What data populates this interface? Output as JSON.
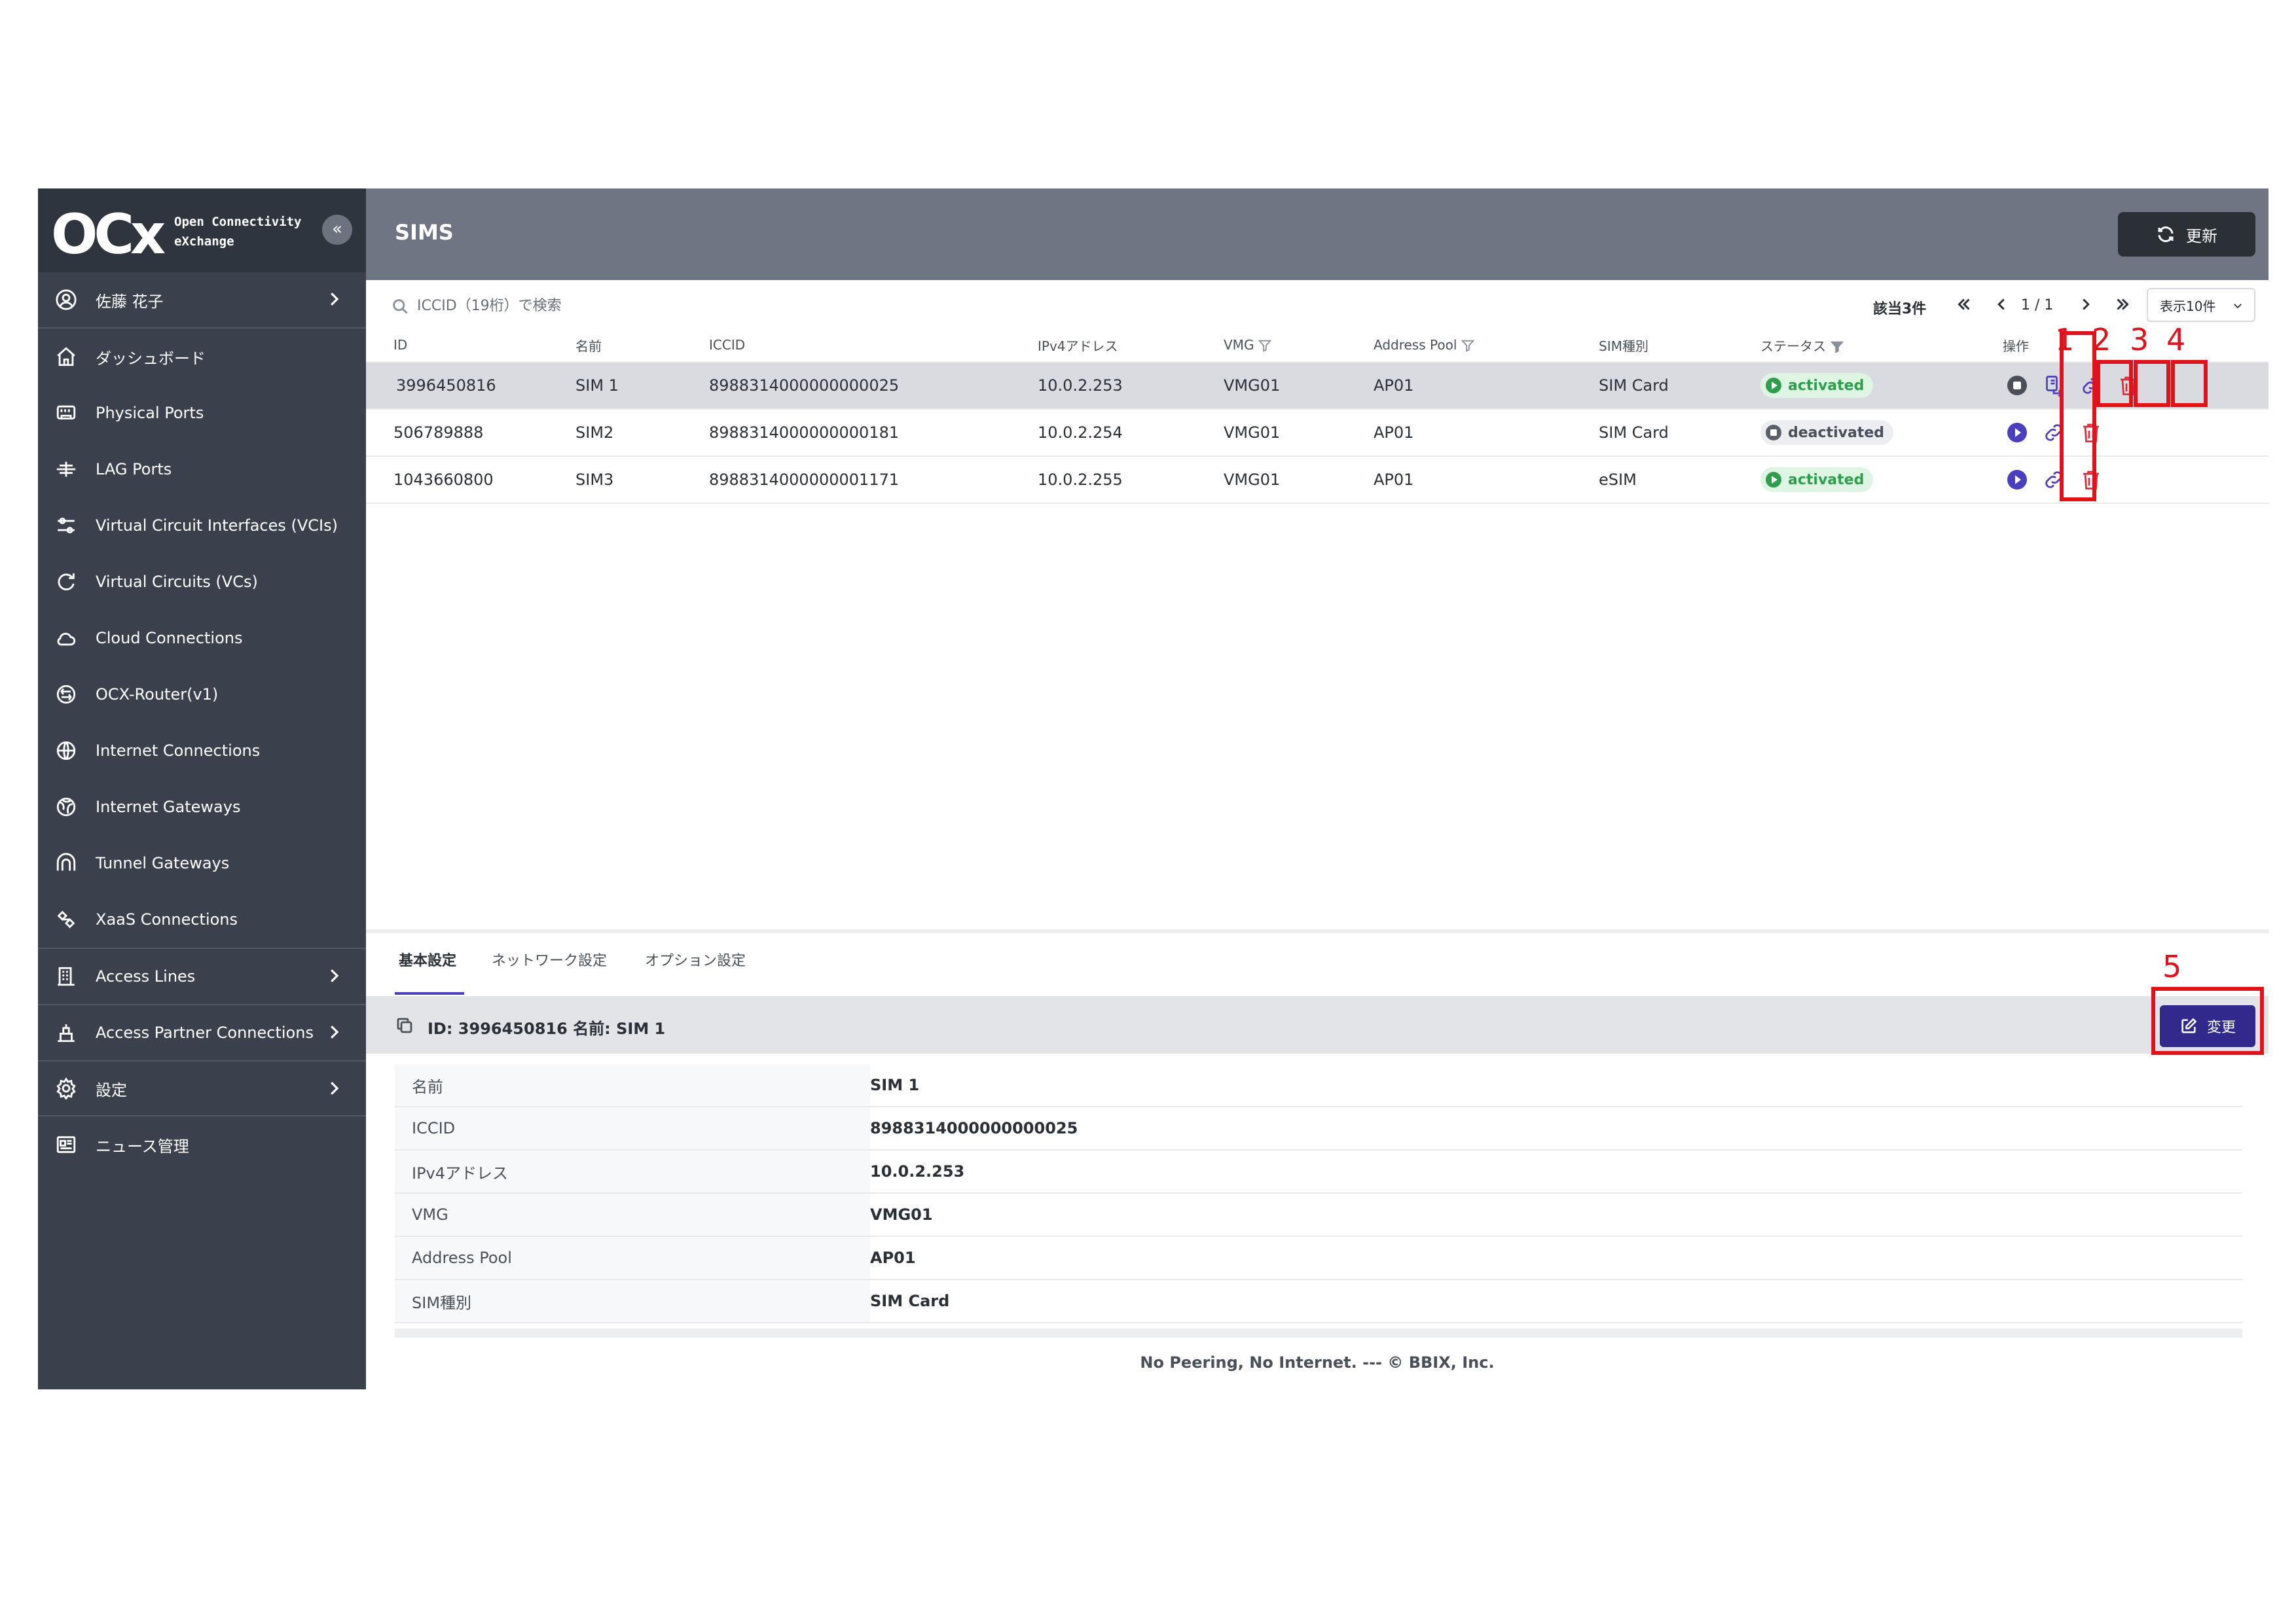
{
  "brand": {
    "logo_text": "OCx",
    "line1": "Open Connectivity",
    "line2": "eXchange",
    "collapse_icon": "«"
  },
  "sidebar": {
    "user": "佐藤 花子",
    "items": [
      {
        "label": "ダッシュボード",
        "icon": "home-icon"
      },
      {
        "label": "Physical Ports",
        "icon": "port-icon"
      },
      {
        "label": "LAG Ports",
        "icon": "lag-icon"
      },
      {
        "label": "Virtual Circuit Interfaces (VCIs)",
        "icon": "sliders-icon"
      },
      {
        "label": "Virtual Circuits (VCs)",
        "icon": "circle-arrow-icon"
      },
      {
        "label": "Cloud Connections",
        "icon": "cloud-icon"
      },
      {
        "label": "OCX-Router(v1)",
        "icon": "router-icon"
      },
      {
        "label": "Internet Connections",
        "icon": "globe-icon"
      },
      {
        "label": "Internet Gateways",
        "icon": "globe-network-icon"
      },
      {
        "label": "Tunnel Gateways",
        "icon": "tunnel-icon"
      },
      {
        "label": "XaaS Connections",
        "icon": "xaas-icon"
      }
    ],
    "groups": [
      {
        "label": "Access Lines",
        "icon": "building-icon"
      },
      {
        "label": "Access Partner Connections",
        "icon": "partner-icon"
      },
      {
        "label": "設定",
        "icon": "gear-icon"
      }
    ],
    "news": "ニュース管理"
  },
  "header": {
    "title": "SIMS",
    "refresh_label": "更新"
  },
  "toolbar": {
    "search_placeholder": "ICCID（19桁）で検索",
    "count": "該当3件",
    "page": "1 / 1",
    "page_size": "表示10件"
  },
  "table": {
    "columns": {
      "id": "ID",
      "name": "名前",
      "iccid": "ICCID",
      "ipv4": "IPv4アドレス",
      "vmg": "VMG",
      "pool": "Address Pool",
      "type": "SIM種別",
      "status": "ステータス",
      "ops": "操作"
    },
    "rows": [
      {
        "id": "3996450816",
        "name": "SIM 1",
        "iccid": "8988314000000000025",
        "ipv4": "10.0.2.253",
        "vmg": "VMG01",
        "pool": "AP01",
        "type": "SIM Card",
        "status": "activated"
      },
      {
        "id": "506789888",
        "name": "SIM2",
        "iccid": "8988314000000000181",
        "ipv4": "10.0.2.254",
        "vmg": "VMG01",
        "pool": "AP01",
        "type": "SIM Card",
        "status": "deactivated"
      },
      {
        "id": "1043660800",
        "name": "SIM3",
        "iccid": "8988314000000001171",
        "ipv4": "10.0.2.255",
        "vmg": "VMG01",
        "pool": "AP01",
        "type": "eSIM",
        "status": "activated"
      }
    ]
  },
  "annotations": {
    "m1": "1",
    "m2": "2",
    "m3": "3",
    "m4": "4",
    "m5": "5",
    "color": "#e0121b"
  },
  "detail": {
    "tabs": [
      "基本設定",
      "ネットワーク設定",
      "オプション設定"
    ],
    "title": "ID: 3996450816  名前: SIM 1",
    "edit_label": "変更",
    "fields": [
      {
        "key": "名前",
        "value": "SIM 1"
      },
      {
        "key": "ICCID",
        "value": "8988314000000000025"
      },
      {
        "key": "IPv4アドレス",
        "value": "10.0.2.253"
      },
      {
        "key": "VMG",
        "value": "VMG01"
      },
      {
        "key": "Address Pool",
        "value": "AP01"
      },
      {
        "key": "SIM種別",
        "value": "SIM Card"
      }
    ]
  },
  "footer": "No Peering, No Internet. --- © BBIX, Inc.",
  "colors": {
    "sidebar": "#3a414d",
    "header": "#6f7582",
    "accent": "#4a3fbf",
    "primary_button": "#2f2a8c",
    "delete": "#d92d3a",
    "activated": "#2e9e4d"
  }
}
